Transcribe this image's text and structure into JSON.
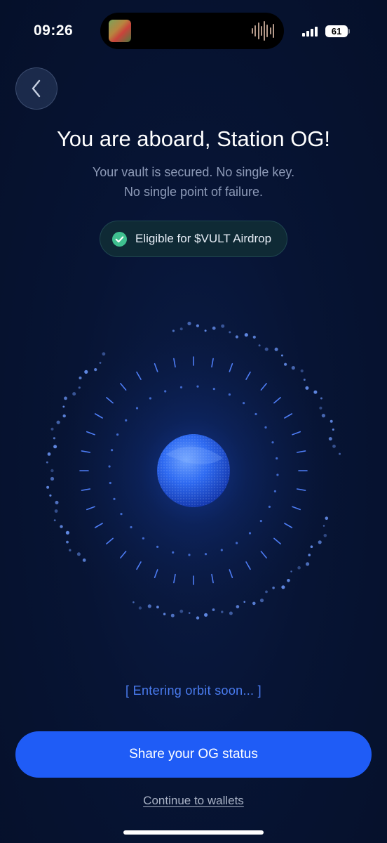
{
  "status_bar": {
    "time": "09:26",
    "battery": "61"
  },
  "header": {
    "back_icon": "chevron-left-icon",
    "title": "You are aboard, Station OG!",
    "subtitle_line1": "Your vault is secured. No single key.",
    "subtitle_line2": "No single point of failure."
  },
  "badge": {
    "icon": "check-circle-icon",
    "label": "Eligible for $VULT Airdrop"
  },
  "orbit": {
    "status_text": "[ Entering orbit soon... ]"
  },
  "actions": {
    "share_label": "Share your OG status",
    "continue_label": "Continue to wallets"
  },
  "colors": {
    "background": "#061230",
    "accent": "#1f5cf6",
    "badge_check": "#3fc08f",
    "orbit_text": "#4a7cf0"
  }
}
